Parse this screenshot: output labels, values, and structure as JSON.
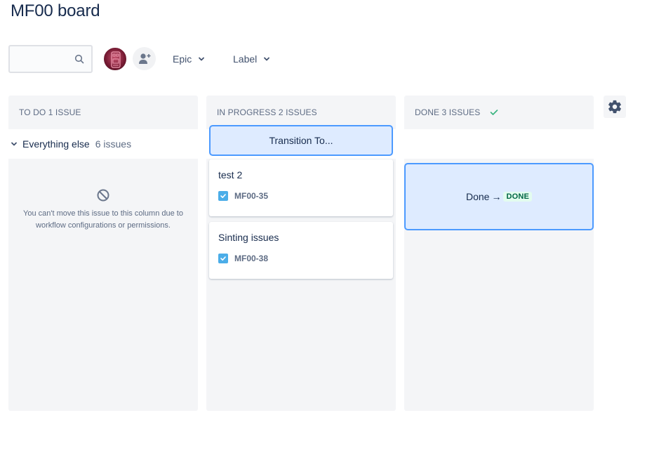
{
  "page": {
    "title": "MF00 board"
  },
  "toolbar": {
    "search": {
      "value": "",
      "placeholder": "",
      "icon": "search-icon"
    },
    "avatar": {
      "icon": "user-avatar"
    },
    "add_people": {
      "icon": "add-person-icon"
    },
    "filters": [
      {
        "label": "Epic",
        "icon": "chevron-down-icon"
      },
      {
        "label": "Label",
        "icon": "chevron-down-icon"
      }
    ]
  },
  "columns": [
    {
      "title": "TO DO 1 ISSUE"
    },
    {
      "title": "IN PROGRESS 2 ISSUES"
    },
    {
      "title": "DONE 3 ISSUES",
      "status_icon": "check-icon"
    }
  ],
  "swimlane": {
    "label": "Everything else",
    "count": "6 issues"
  },
  "todo_blocked": {
    "icon": "blocked-icon",
    "message": "You can't move this issue to this column due to workflow configurations or permissions."
  },
  "in_progress": {
    "transition_label": "Transition To...",
    "cards": [
      {
        "summary": "test 2",
        "key": "MF00-35",
        "type_icon": "task-checkbox-icon"
      },
      {
        "summary": "Sinting issues",
        "key": "MF00-38",
        "type_icon": "task-checkbox-icon"
      }
    ]
  },
  "done_drop": {
    "from": "Done",
    "arrow": "→",
    "to_status": "DONE"
  },
  "settings": {
    "icon": "gear-icon"
  },
  "colors": {
    "accent_border": "#4c9aff",
    "drop_bg": "#deebff",
    "column_bg": "#f4f5f7",
    "done_lozenge_bg": "#e3fcef",
    "done_lozenge_text": "#006644",
    "task_icon": "#4bade8"
  }
}
